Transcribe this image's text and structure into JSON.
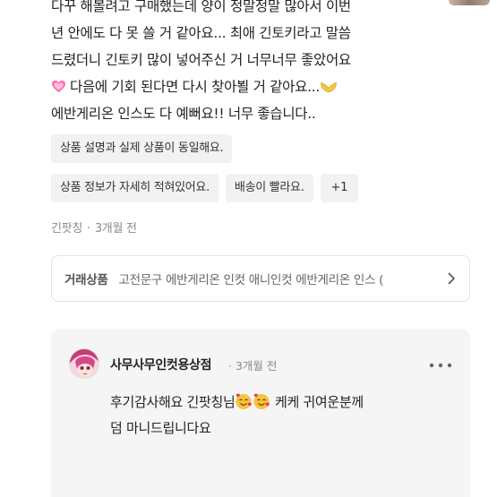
{
  "review": {
    "lines": [
      "다꾸 해볼려고 구매했는데 양이 정말정말 많아서 이번",
      "년 안에도 다 못 쓸 거 같아요... 최애 긴토키라고 말씀",
      "드렸더니 긴토키 많이 넣어주신 거 너무너무 좋았어요",
      "다음에 기회 된다면 다시 찾아뵐 거 같아요...",
      "에반게리온 인스도 다 예뻐요!! 너무 좋습니다.."
    ],
    "emoji": {
      "heart": "pink-heart-icon",
      "hands": "heart-hands-icon"
    }
  },
  "tags": [
    "상품 설명과 실제 상품이 동일해요.",
    "상품 정보가 자세히 적혀있어요.",
    "배송이 빨라요.",
    "+1"
  ],
  "meta": {
    "author": "긴팟칭",
    "time": "3개월 전"
  },
  "product": {
    "label": "거래상품",
    "name": "고전문구 에반게리온 인컷 애니인컷 에반게리온 인스 (",
    "icon": "chevron-right-icon"
  },
  "reply": {
    "shop_name": "사무사무인컷용상점",
    "time": "3개월 전",
    "line1": "후기감사해요 긴팟칭님",
    "line1_after": " 케케 귀여운분께",
    "line2": "덤 마니드립니다요",
    "icons": {
      "emoji": "smiling-face-with-hearts-icon",
      "more": "more-dots-icon"
    }
  },
  "colors": {
    "tag_bg": "#f2f2f2",
    "reply_bg": "#f5f5f5",
    "meta": "#8a8a8a",
    "heart": "#ff6fb0"
  }
}
